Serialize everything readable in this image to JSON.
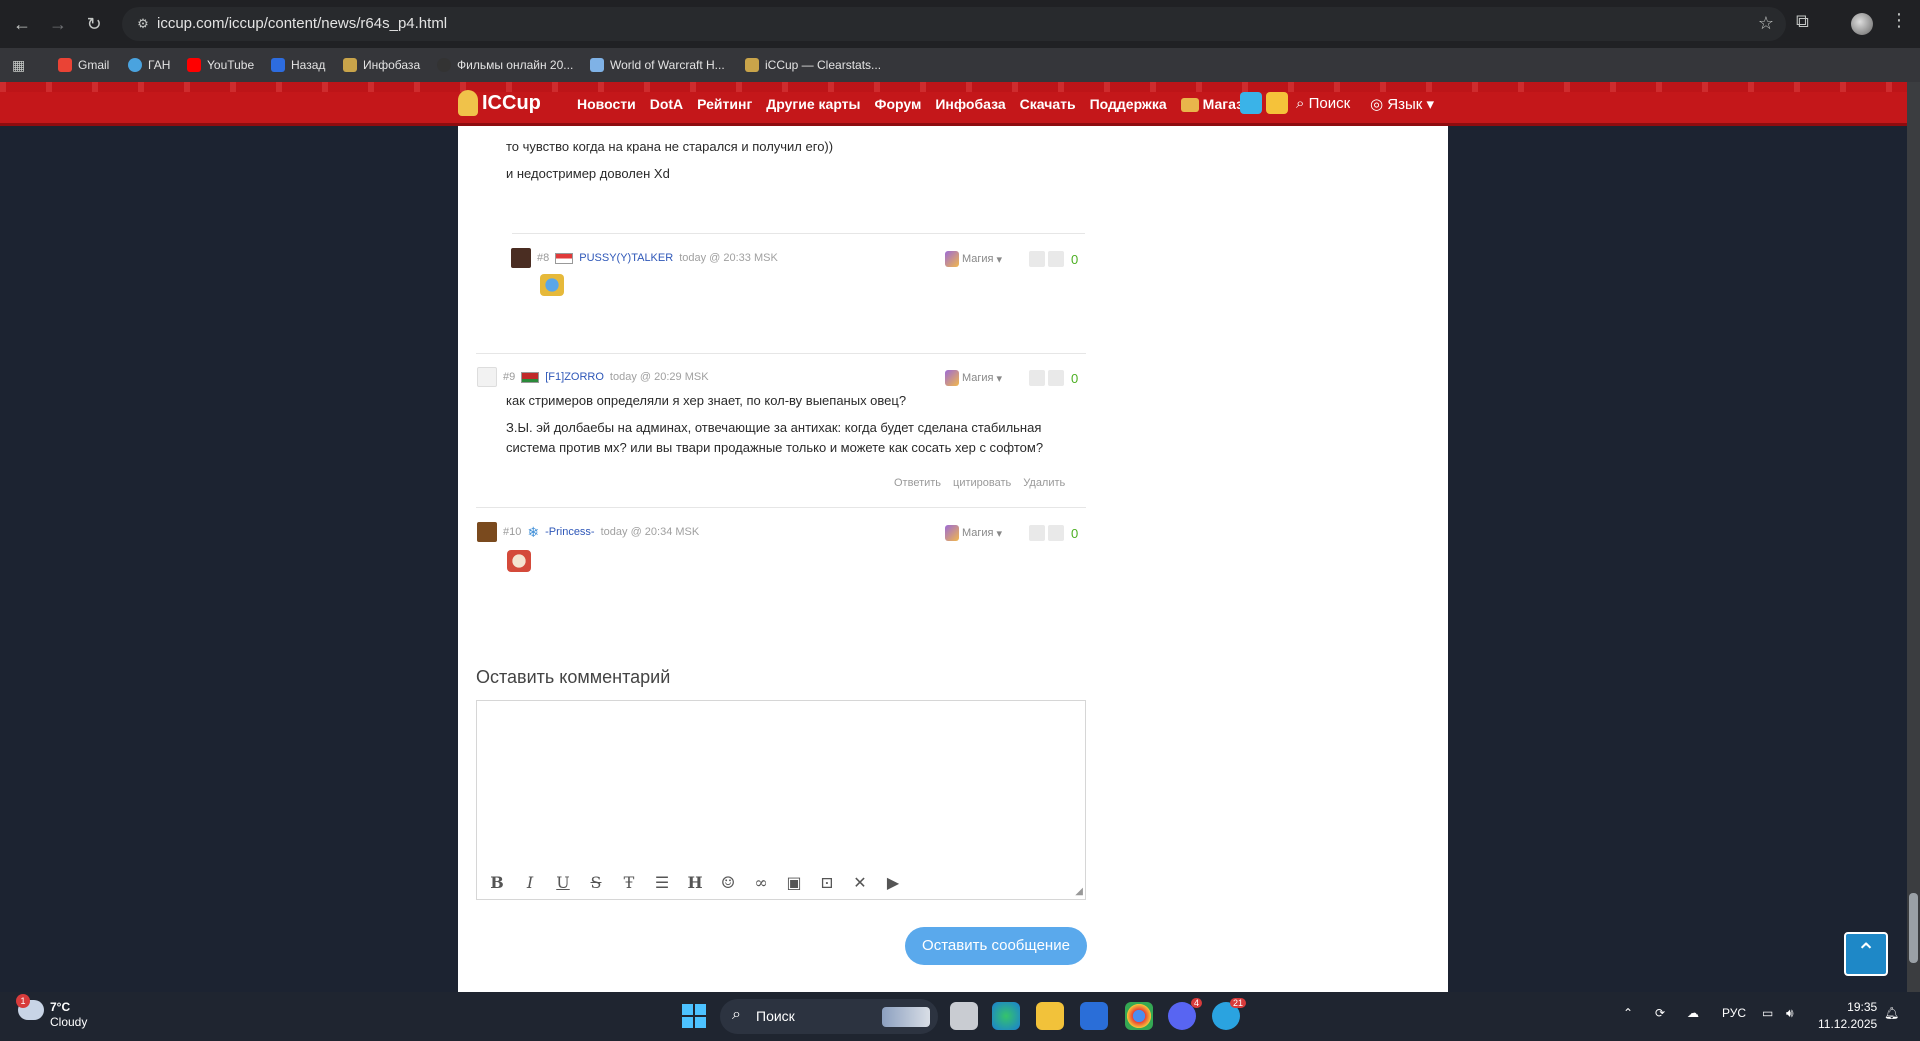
{
  "browser": {
    "url": "iccup.com/iccup/content/news/r64s_p4.html",
    "bookmarks": [
      "Gmail",
      "ГАН",
      "YouTube",
      "Назад",
      "Инфобаза",
      "Фильмы онлайн 20...",
      "World of Warcraft H...",
      "iCCup — Clearstats..."
    ]
  },
  "site": {
    "logo": "ICCup",
    "nav": [
      "Новости",
      "DotA",
      "Рейтинг",
      "Другие карты",
      "Форум",
      "Инфобаза",
      "Скачать",
      "Поддержка",
      "Магазин"
    ],
    "search": "Поиск",
    "lang": "Язык"
  },
  "comments": {
    "prev_line1": "то чувство когда на крана не старался и получил его))",
    "prev_line2": "и недостример доволен Xd",
    "c8": {
      "num": "#8",
      "name": "PUSSY(Y)TALKER",
      "time": "today @ 20:33 MSK",
      "magic": "Магия",
      "votes": "0"
    },
    "c9": {
      "num": "#9",
      "name": "[F1]ZORRO",
      "time": "today @ 20:29 MSK",
      "magic": "Магия",
      "votes": "0",
      "text1": "как стримеров определяли я хер знает, по кол-ву выепаных овец?",
      "text2": "З.Ы. эй долбаебы на админах, отвечающие за антихак: когда будет сделана стабильная",
      "text3": "система против мх? или вы твари продажные только и можете как сосать хер с софтом?",
      "reply": "Ответить",
      "quote": "цитировать",
      "delete": "Удалить"
    },
    "c10": {
      "num": "#10",
      "name": "-Princess-",
      "time": "today @ 20:34 MSK",
      "magic": "Магия",
      "votes": "0"
    }
  },
  "form": {
    "title": "Оставить комментарий",
    "submit": "Оставить сообщение"
  },
  "taskbar": {
    "temp": "7°C",
    "condition": "Cloudy",
    "weather_badge": "1",
    "search": "Поиск",
    "discord_badge": "4",
    "telegram_badge": "21",
    "lang": "РУС",
    "time": "19:35",
    "date": "11.12.2025"
  }
}
